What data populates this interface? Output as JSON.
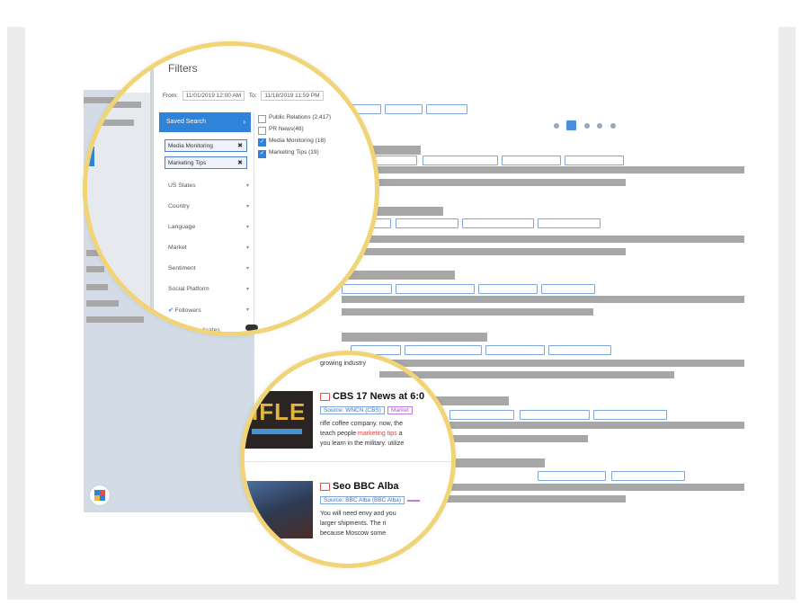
{
  "filters": {
    "title": "Filters",
    "from_label": "From",
    "from_value": "11/01/2019 12:00 AM",
    "to_label": "To",
    "to_value": "11/18/2019 11:59 PM",
    "saved_search": "Saved Search",
    "tags": [
      "Media Monitoring",
      "Marketing Tips"
    ],
    "tag_remove": "✖",
    "items": [
      "US States",
      "Country",
      "Language",
      "Market",
      "Sentiment",
      "Social Platform",
      "Followers",
      "Exclude Duplicates"
    ],
    "checkboxes": [
      {
        "label": "Public Relations (2,417)",
        "checked": false
      },
      {
        "label": "PR News(48)",
        "checked": false
      },
      {
        "label": "Media Monitoring (18)",
        "checked": true
      },
      {
        "label": "Marketing Tips (19)",
        "checked": true
      }
    ]
  },
  "news": {
    "snippet_top": "growing industry",
    "items": [
      {
        "title": "CBS 17 News at 6:0",
        "source": "Source: WNCN (CBS)",
        "market": "Market",
        "line1": "rifle coffee company. now, the",
        "line2_pre": "teach people ",
        "line2_hl": "marketing tips",
        "line2_post": " a",
        "line3": "you learn in the military. utilize",
        "thumb_brand": "IFLE"
      },
      {
        "title": "Seo BBC Alba",
        "source": "Source: BBC Alba (BBC Alba)",
        "line1": "You will need envy and you",
        "line2": "larger shipments. The ri",
        "line3": "because Moscow some"
      }
    ]
  },
  "pager": {
    "active_page": 1,
    "page_count": 5
  },
  "colors": {
    "accent": "#2f84da",
    "magnifier_ring": "#f1d476",
    "highlight": "#e23d3d"
  }
}
